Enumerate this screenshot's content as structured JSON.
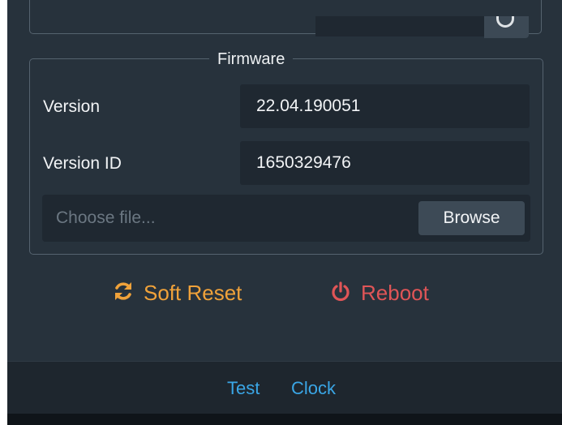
{
  "firmware": {
    "legend": "Firmware",
    "version_label": "Version",
    "version_value": "22.04.190051",
    "version_id_label": "Version ID",
    "version_id_value": "1650329476",
    "file_placeholder": "Choose file...",
    "browse_label": "Browse"
  },
  "actions": {
    "soft_reset_label": "Soft Reset",
    "reboot_label": "Reboot"
  },
  "footer": {
    "links": [
      "Test",
      "Clock"
    ]
  },
  "colors": {
    "soft_reset": "#f0a23a",
    "reboot": "#e05557",
    "link": "#3aa6e6",
    "panel": "#27323c"
  },
  "icons": {
    "soft_reset": "sync-icon",
    "reboot": "power-icon"
  }
}
